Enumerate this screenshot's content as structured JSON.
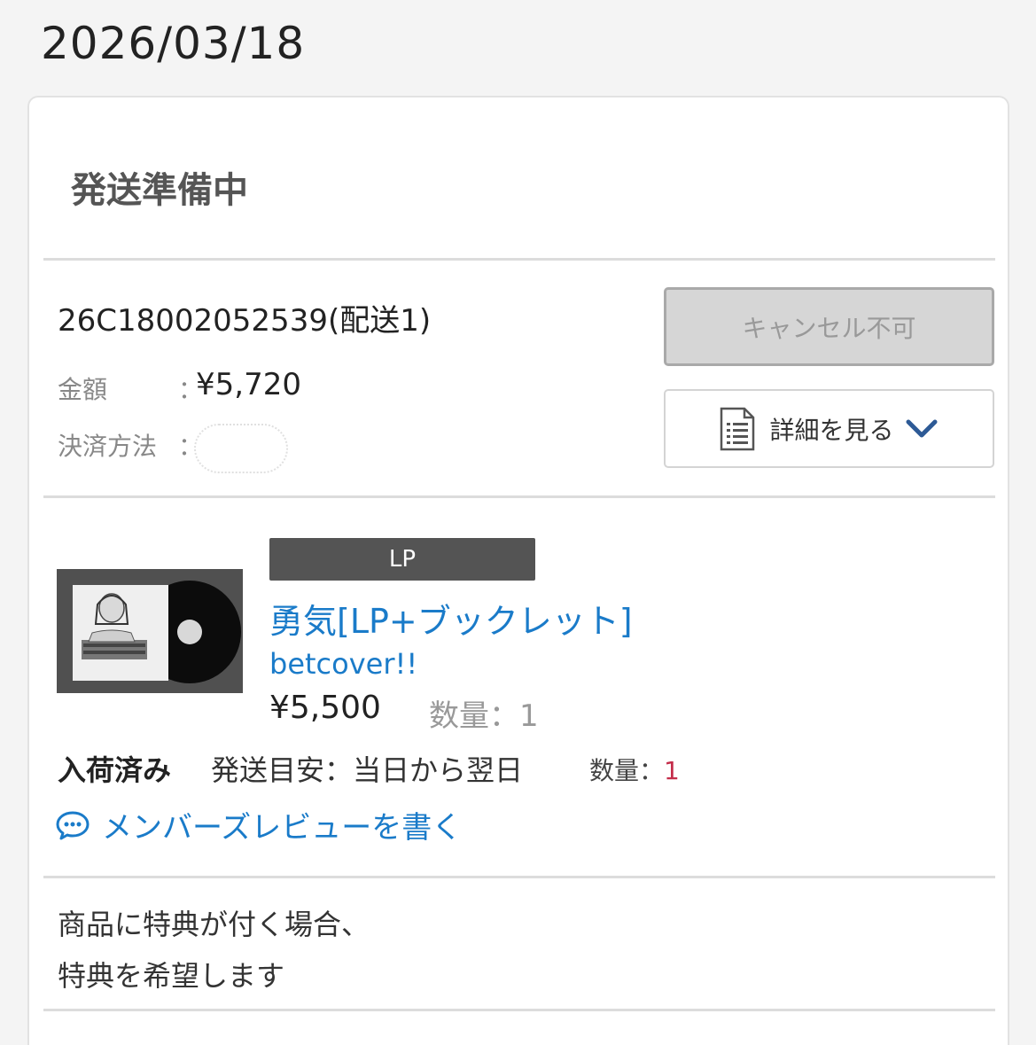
{
  "header": {
    "date": "2026/03/18"
  },
  "order": {
    "status": "発送準備中",
    "number": "26C18002052539(配送1)",
    "amount_label": "金額",
    "amount_colon": "：",
    "amount": "¥5,720",
    "payment_label": "決済方法",
    "payment_colon": "："
  },
  "buttons": {
    "cancel_label": "キャンセル不可",
    "detail_label": "詳細を見る"
  },
  "item": {
    "format": "LP",
    "title": "勇気[LP+ブックレット]",
    "artist": "betcover!!",
    "price": "¥5,500",
    "qty_label": "数量：1",
    "stock_status": "入荷済み",
    "shipping": "発送目安：当日から翌日",
    "qty2_label": "数量：",
    "qty2_value": "1",
    "review_link": "メンバーズレビューを書く"
  },
  "note": {
    "line1": "商品に特典が付く場合、",
    "line2": "特典を希望します"
  },
  "colors": {
    "link": "#1a7bc9",
    "badge": "#545454",
    "qty_value": "#c42d4a"
  },
  "icons": [
    "document-icon",
    "chevron-down-icon",
    "chat-bubble-icon"
  ]
}
